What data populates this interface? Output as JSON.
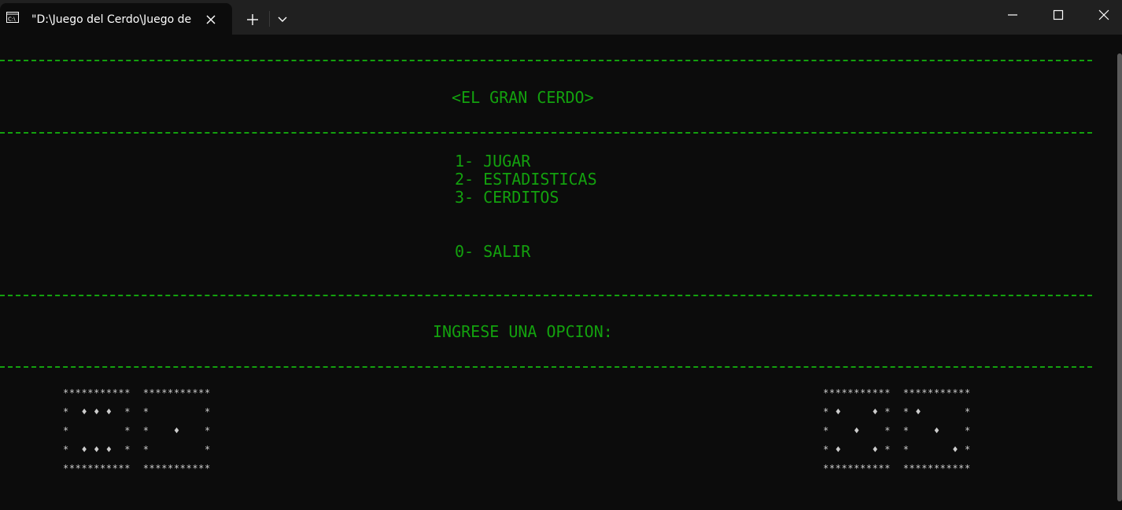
{
  "window": {
    "tab_title": "\"D:\\Juego del Cerdo\\Juego de",
    "icons": {
      "tab": "terminal-icon",
      "close_tab": "close-icon",
      "new_tab": "plus-icon",
      "dropdown": "chevron-down-icon",
      "minimize": "minimize-icon",
      "maximize": "maximize-icon",
      "close": "close-icon"
    }
  },
  "console": {
    "title": "<EL GRAN CERDO>",
    "menu": [
      "1- JUGAR",
      "2- ESTADISTICAS",
      "3- CERDITOS"
    ],
    "exit_option": "0- SALIR",
    "prompt": "INGRESE UNA OPCION:",
    "dice_art": {
      "left": "***********  ***********\n*  ♦ ♦ ♦  *  *         *\n*         *  *    ♦    *\n*  ♦ ♦ ♦  *  *         *\n***********  ***********",
      "right": "***********  ***********\n* ♦     ♦ *  * ♦       *\n*    ♦    *  *    ♦    *\n* ♦     ♦ *  *       ♦ *\n***********  ***********"
    }
  },
  "colors": {
    "terminal_bg": "#0c0c0c",
    "terminal_text": "#13a10e",
    "title_bar_bg": "#202020",
    "art_text": "#cccccc"
  }
}
